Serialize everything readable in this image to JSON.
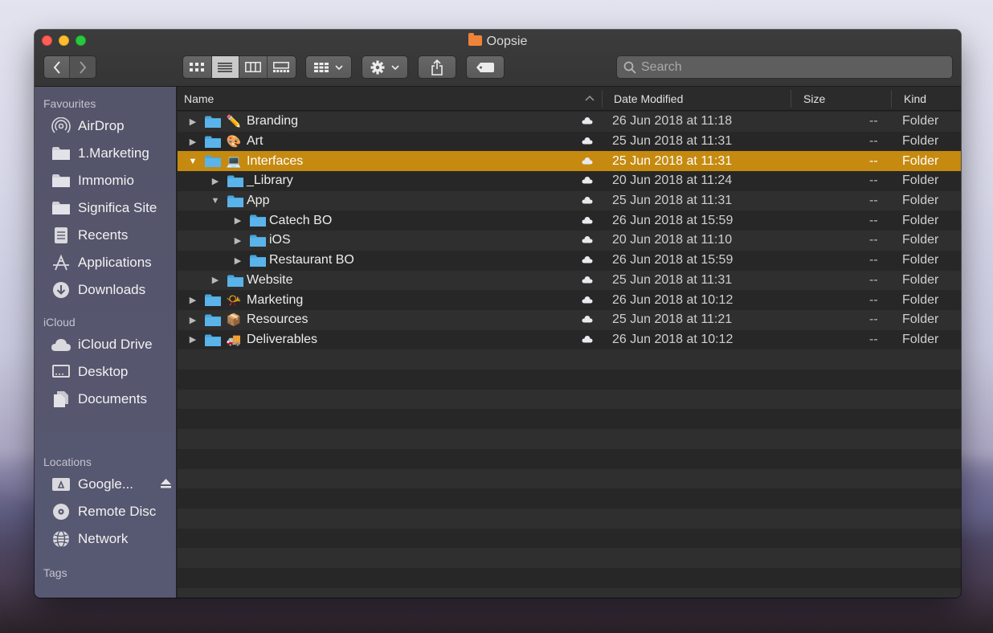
{
  "window": {
    "title": "Oopsie"
  },
  "toolbar": {
    "back": "‹",
    "forward": "›",
    "search_placeholder": "Search"
  },
  "sidebar": {
    "favourites_heading": "Favourites",
    "favourites": [
      {
        "label": "AirDrop",
        "icon": "airdrop-icon"
      },
      {
        "label": "1.Marketing",
        "icon": "folder-icon"
      },
      {
        "label": "Immomio",
        "icon": "folder-icon"
      },
      {
        "label": "Significa Site",
        "icon": "folder-icon"
      },
      {
        "label": "Recents",
        "icon": "recents-icon"
      },
      {
        "label": "Applications",
        "icon": "applications-icon"
      },
      {
        "label": "Downloads",
        "icon": "downloads-icon"
      }
    ],
    "icloud_heading": "iCloud",
    "icloud": [
      {
        "label": "iCloud Drive",
        "icon": "cloud-icon"
      },
      {
        "label": "Desktop",
        "icon": "desktop-icon"
      },
      {
        "label": "Documents",
        "icon": "documents-icon"
      }
    ],
    "locations_heading": "Locations",
    "locations": [
      {
        "label": "Google...",
        "icon": "google-drive-icon"
      },
      {
        "label": "Remote Disc",
        "icon": "disc-icon"
      },
      {
        "label": "Network",
        "icon": "network-icon"
      }
    ],
    "tags_heading": "Tags"
  },
  "columns": {
    "name": "Name",
    "date": "Date Modified",
    "size": "Size",
    "kind": "Kind"
  },
  "rows": [
    {
      "name": "Branding",
      "emoji": "✏️",
      "level": 0,
      "expanded": false,
      "date": "26 Jun 2018 at 11:18",
      "size": "--",
      "kind": "Folder"
    },
    {
      "name": "Art",
      "emoji": "🎨",
      "level": 0,
      "expanded": false,
      "date": "25 Jun 2018 at 11:31",
      "size": "--",
      "kind": "Folder"
    },
    {
      "name": "Interfaces",
      "emoji": "💻",
      "level": 0,
      "expanded": true,
      "selected": true,
      "date": "25 Jun 2018 at 11:31",
      "size": "--",
      "kind": "Folder"
    },
    {
      "name": "_Library",
      "emoji": "",
      "level": 1,
      "expanded": false,
      "date": "20 Jun 2018 at 11:24",
      "size": "--",
      "kind": "Folder"
    },
    {
      "name": "App",
      "emoji": "",
      "level": 1,
      "expanded": true,
      "date": "25 Jun 2018 at 11:31",
      "size": "--",
      "kind": "Folder"
    },
    {
      "name": "Catech BO",
      "emoji": "",
      "level": 2,
      "expanded": false,
      "date": "26 Jun 2018 at 15:59",
      "size": "--",
      "kind": "Folder"
    },
    {
      "name": "iOS",
      "emoji": "",
      "level": 2,
      "expanded": false,
      "date": "20 Jun 2018 at 11:10",
      "size": "--",
      "kind": "Folder"
    },
    {
      "name": "Restaurant BO",
      "emoji": "",
      "level": 2,
      "expanded": false,
      "date": "26 Jun 2018 at 15:59",
      "size": "--",
      "kind": "Folder"
    },
    {
      "name": "Website",
      "emoji": "",
      "level": 1,
      "expanded": false,
      "date": "25 Jun 2018 at 11:31",
      "size": "--",
      "kind": "Folder"
    },
    {
      "name": "Marketing",
      "emoji": "📯",
      "level": 0,
      "expanded": false,
      "date": "26 Jun 2018 at 10:12",
      "size": "--",
      "kind": "Folder"
    },
    {
      "name": "Resources",
      "emoji": "📦",
      "level": 0,
      "expanded": false,
      "date": "25 Jun 2018 at 11:21",
      "size": "--",
      "kind": "Folder"
    },
    {
      "name": "Deliverables",
      "emoji": "🚚",
      "level": 0,
      "expanded": false,
      "date": "26 Jun 2018 at 10:12",
      "size": "--",
      "kind": "Folder"
    }
  ],
  "colors": {
    "selection": "#c58a0f",
    "folder": "#4aa6dc",
    "close": "#fe5f57",
    "minimize": "#febc2e",
    "zoom": "#28c840"
  }
}
